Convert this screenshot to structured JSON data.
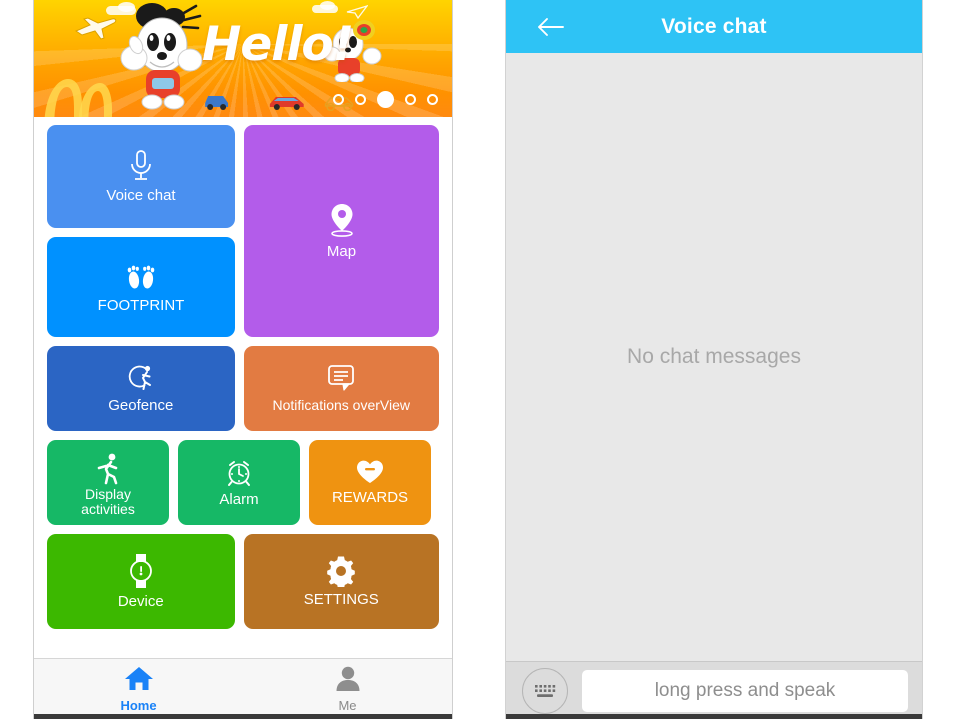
{
  "home": {
    "banner": {
      "greeting": "Hello!",
      "pager": {
        "total": 5,
        "active_index": 2
      }
    },
    "tiles": [
      {
        "id": "voice-chat",
        "label": "Voice chat",
        "icon": "microphone-icon",
        "color": "#4a90f0"
      },
      {
        "id": "footprint",
        "label": "FOOTPRINT",
        "icon": "footprints-icon",
        "color": "#0091ff"
      },
      {
        "id": "map",
        "label": "Map",
        "icon": "map-pin-icon",
        "color": "#b35cea"
      },
      {
        "id": "geofence",
        "label": "Geofence",
        "icon": "geofence-icon",
        "color": "#2b65c4"
      },
      {
        "id": "notifications",
        "label": "Notifications overView",
        "icon": "speech-bubble-icon",
        "color": "#e27b42"
      },
      {
        "id": "display-activities",
        "label": "Display\nactivities",
        "label_line1": "Display",
        "label_line2": "activities",
        "icon": "runner-icon",
        "color": "#16b866"
      },
      {
        "id": "alarm",
        "label": "Alarm",
        "icon": "alarm-clock-icon",
        "color": "#16b866"
      },
      {
        "id": "rewards",
        "label": "REWARDS",
        "icon": "heart-icon",
        "color": "#ef9311"
      },
      {
        "id": "device",
        "label": "Device",
        "icon": "watch-icon",
        "color": "#3cb800"
      },
      {
        "id": "settings",
        "label": "SETTINGS",
        "icon": "gear-icon",
        "color": "#b87324"
      }
    ],
    "bottom_nav": [
      {
        "id": "home",
        "label": "Home",
        "icon": "house-icon",
        "active": true,
        "color": "#1a82f7"
      },
      {
        "id": "me",
        "label": "Me",
        "icon": "person-icon",
        "active": false,
        "color": "#8a8a8a"
      }
    ]
  },
  "voice_chat": {
    "header": {
      "title": "Voice chat",
      "back_icon": "back-arrow-icon",
      "color": "#2ec3f5"
    },
    "empty_state": "No chat messages",
    "footer": {
      "keyboard_icon": "keyboard-icon",
      "speak_placeholder": "long press and speak"
    }
  }
}
